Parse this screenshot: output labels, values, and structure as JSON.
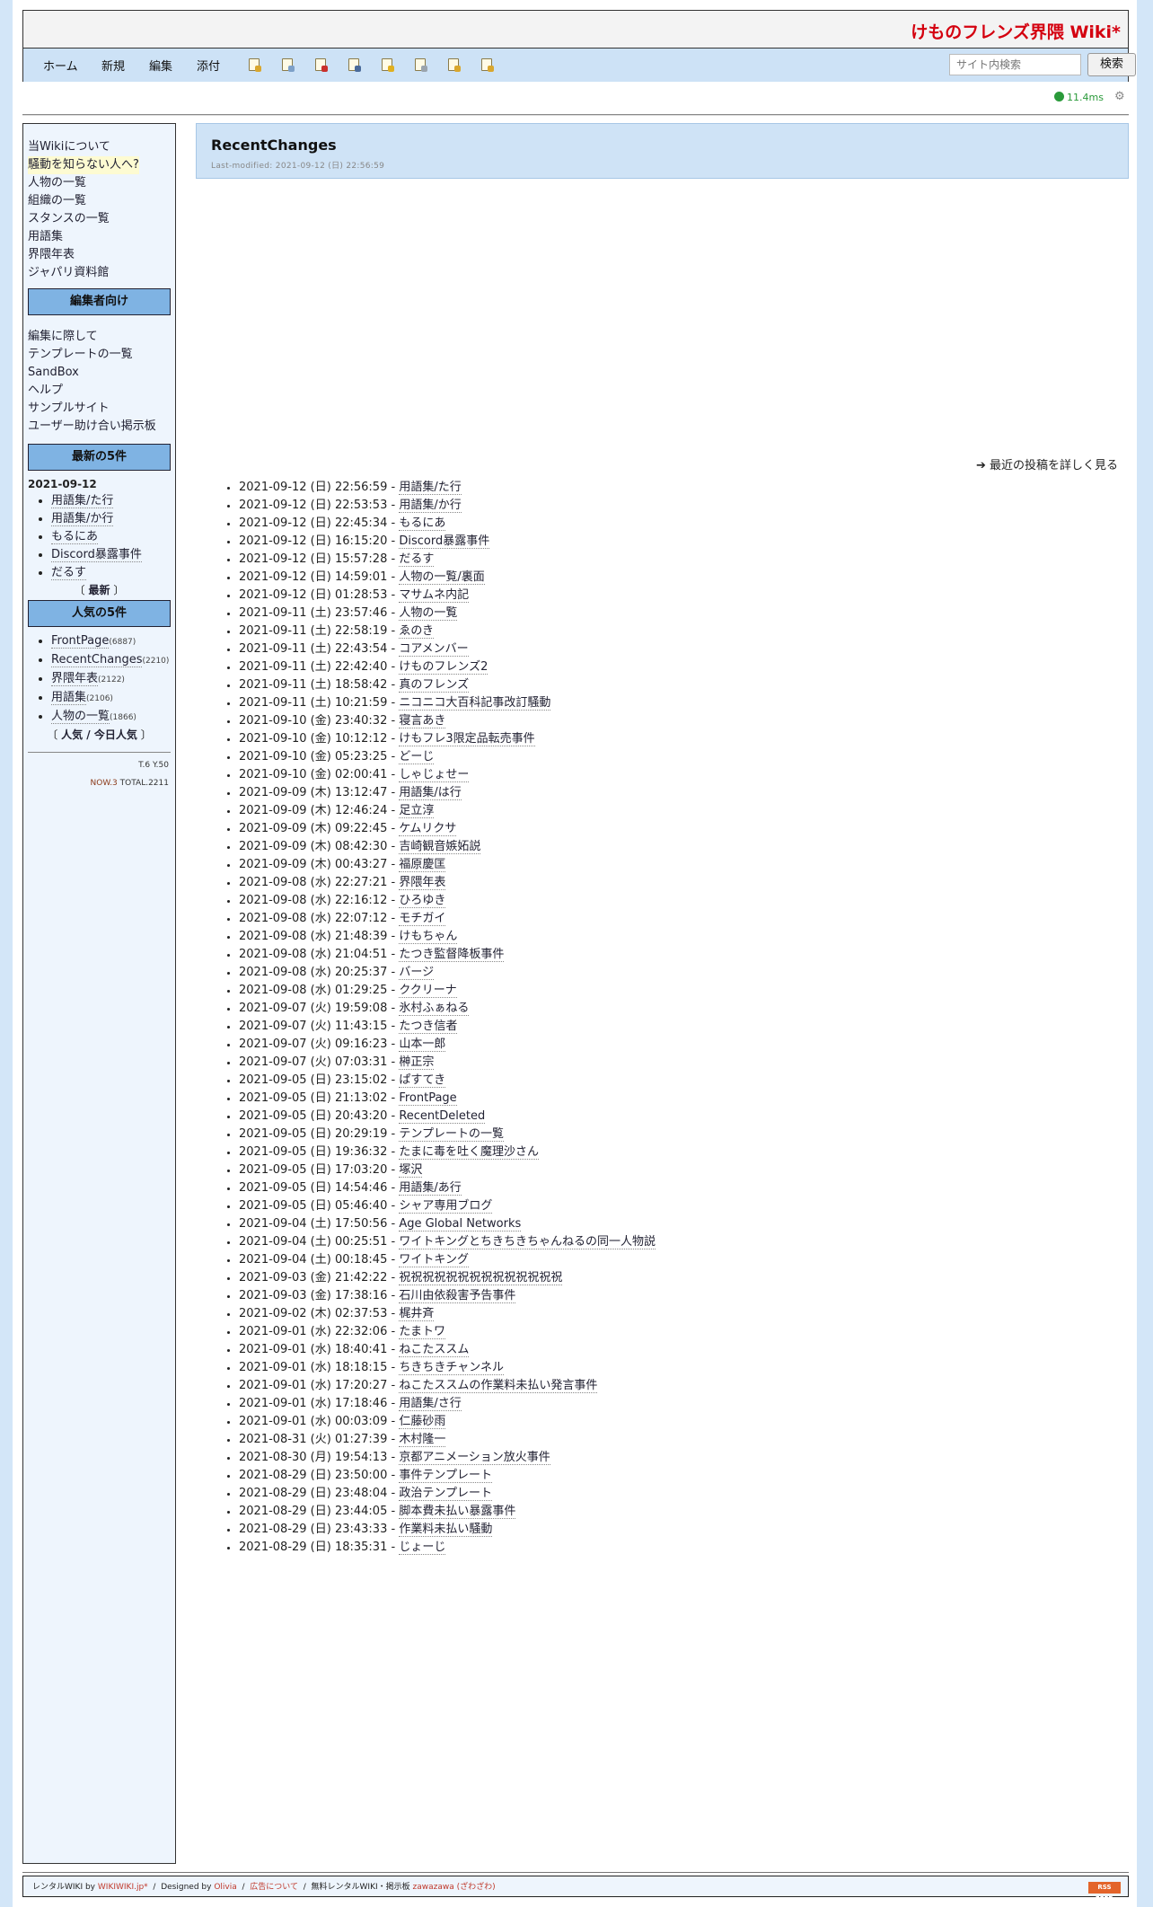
{
  "site_title": "けものフレンズ界隈 Wiki*",
  "menu": [
    "ホーム",
    "新規",
    "編集",
    "添付"
  ],
  "toolbar_icons": [
    "new-page-icon",
    "copy-page-icon",
    "diff-icon",
    "backup-icon",
    "lock-icon",
    "list-icon",
    "search-page-icon",
    "help-page-icon"
  ],
  "search": {
    "placeholder": "サイト内検索",
    "button": "検索"
  },
  "render_time": "11.4ms",
  "sidebar": {
    "links": [
      "当Wikiについて",
      "騒動を知らない人へ?",
      "人物の一覧",
      "組織の一覧",
      "スタンスの一覧",
      "用語集",
      "界隈年表",
      "ジャパリ資料館"
    ],
    "editors_heading": "編集者向け",
    "editor_links": [
      "編集に際して",
      "テンプレートの一覧",
      "SandBox",
      "ヘルプ",
      "サンプルサイト",
      "ユーザー助け合い掲示板"
    ],
    "recent_heading": "最新の5件",
    "recent_date": "2021-09-12",
    "recent": [
      "用語集/た行",
      "用語集/か行",
      "もるにあ",
      "Discord暴露事件",
      "だるす"
    ],
    "recent_more_open": "〔",
    "recent_more": "最新",
    "recent_more_close": "〕",
    "popular_heading": "人気の5件",
    "popular": [
      {
        "name": "FrontPage",
        "count": "(6887)"
      },
      {
        "name": "RecentChanges",
        "count": "(2210)"
      },
      {
        "name": "界隈年表",
        "count": "(2122)"
      },
      {
        "name": "用語集",
        "count": "(2106)"
      },
      {
        "name": "人物の一覧",
        "count": "(1866)"
      }
    ],
    "popular_more_open": "〔",
    "popular_more": "人気 / 今日人気",
    "popular_more_close": "〕",
    "counter_ty": "T.6 Y.50",
    "counter_now": "NOW.3",
    "counter_total": "TOTAL.2211"
  },
  "page": {
    "title": "RecentChanges",
    "last_modified": "Last-modified: 2021-09-12 (日) 22:56:59",
    "detail_link": "最近の投稿を詳しく見る"
  },
  "changes": [
    {
      "time": "2021-09-12 (日) 22:56:59",
      "page": "用語集/た行"
    },
    {
      "time": "2021-09-12 (日) 22:53:53",
      "page": "用語集/か行"
    },
    {
      "time": "2021-09-12 (日) 22:45:34",
      "page": "もるにあ"
    },
    {
      "time": "2021-09-12 (日) 16:15:20",
      "page": "Discord暴露事件"
    },
    {
      "time": "2021-09-12 (日) 15:57:28",
      "page": "だるす"
    },
    {
      "time": "2021-09-12 (日) 14:59:01",
      "page": "人物の一覧/裏面"
    },
    {
      "time": "2021-09-12 (日) 01:28:53",
      "page": "マサムネ内記"
    },
    {
      "time": "2021-09-11 (土) 23:57:46",
      "page": "人物の一覧"
    },
    {
      "time": "2021-09-11 (土) 22:58:19",
      "page": "ゑのき"
    },
    {
      "time": "2021-09-11 (土) 22:43:54",
      "page": "コアメンバー"
    },
    {
      "time": "2021-09-11 (土) 22:42:40",
      "page": "けものフレンズ2"
    },
    {
      "time": "2021-09-11 (土) 18:58:42",
      "page": "真のフレンズ"
    },
    {
      "time": "2021-09-11 (土) 10:21:59",
      "page": "ニコニコ大百科記事改訂騒動"
    },
    {
      "time": "2021-09-10 (金) 23:40:32",
      "page": "寝言あき"
    },
    {
      "time": "2021-09-10 (金) 10:12:12",
      "page": "けもフレ3限定品転売事件"
    },
    {
      "time": "2021-09-10 (金) 05:23:25",
      "page": "どーじ"
    },
    {
      "time": "2021-09-10 (金) 02:00:41",
      "page": "しゃじょせー"
    },
    {
      "time": "2021-09-09 (木) 13:12:47",
      "page": "用語集/は行"
    },
    {
      "time": "2021-09-09 (木) 12:46:24",
      "page": "足立淳"
    },
    {
      "time": "2021-09-09 (木) 09:22:45",
      "page": "ケムリクサ"
    },
    {
      "time": "2021-09-09 (木) 08:42:30",
      "page": "吉崎観音嫉妬説"
    },
    {
      "time": "2021-09-09 (木) 00:43:27",
      "page": "福原慶匡"
    },
    {
      "time": "2021-09-08 (水) 22:27:21",
      "page": "界隈年表"
    },
    {
      "time": "2021-09-08 (水) 22:16:12",
      "page": "ひろゆき"
    },
    {
      "time": "2021-09-08 (水) 22:07:12",
      "page": "モチガイ"
    },
    {
      "time": "2021-09-08 (水) 21:48:39",
      "page": "けもちゃん"
    },
    {
      "time": "2021-09-08 (水) 21:04:51",
      "page": "たつき監督降板事件"
    },
    {
      "time": "2021-09-08 (水) 20:25:37",
      "page": "バージ"
    },
    {
      "time": "2021-09-08 (水) 01:29:25",
      "page": "ククリーナ"
    },
    {
      "time": "2021-09-07 (火) 19:59:08",
      "page": "氷村ふぁねる"
    },
    {
      "time": "2021-09-07 (火) 11:43:15",
      "page": "たつき信者"
    },
    {
      "time": "2021-09-07 (火) 09:16:23",
      "page": "山本一郎"
    },
    {
      "time": "2021-09-07 (火) 07:03:31",
      "page": "榊正宗"
    },
    {
      "time": "2021-09-05 (日) 23:15:02",
      "page": "ぱすてき"
    },
    {
      "time": "2021-09-05 (日) 21:13:02",
      "page": "FrontPage"
    },
    {
      "time": "2021-09-05 (日) 20:43:20",
      "page": "RecentDeleted"
    },
    {
      "time": "2021-09-05 (日) 20:29:19",
      "page": "テンプレートの一覧"
    },
    {
      "time": "2021-09-05 (日) 19:36:32",
      "page": "たまに毒を吐く魔理沙さん"
    },
    {
      "time": "2021-09-05 (日) 17:03:20",
      "page": "塚沢"
    },
    {
      "time": "2021-09-05 (日) 14:54:46",
      "page": "用語集/あ行"
    },
    {
      "time": "2021-09-05 (日) 05:46:40",
      "page": "シャア専用ブログ"
    },
    {
      "time": "2021-09-04 (土) 17:50:56",
      "page": "Age Global Networks"
    },
    {
      "time": "2021-09-04 (土) 00:25:51",
      "page": "ワイトキングとちきちきちゃんねるの同一人物説"
    },
    {
      "time": "2021-09-04 (土) 00:18:45",
      "page": "ワイトキング"
    },
    {
      "time": "2021-09-03 (金) 21:42:22",
      "page": "祝祝祝祝祝祝祝祝祝祝祝祝祝祝"
    },
    {
      "time": "2021-09-03 (金) 17:38:16",
      "page": "石川由依殺害予告事件"
    },
    {
      "time": "2021-09-02 (木) 02:37:53",
      "page": "梶井斉"
    },
    {
      "time": "2021-09-01 (水) 22:32:06",
      "page": "たまトワ"
    },
    {
      "time": "2021-09-01 (水) 18:40:41",
      "page": "ねこたススム"
    },
    {
      "time": "2021-09-01 (水) 18:18:15",
      "page": "ちきちきチャンネル"
    },
    {
      "time": "2021-09-01 (水) 17:20:27",
      "page": "ねこたススムの作業料未払い発言事件"
    },
    {
      "time": "2021-09-01 (水) 17:18:46",
      "page": "用語集/さ行"
    },
    {
      "time": "2021-09-01 (水) 00:03:09",
      "page": "仁藤砂雨"
    },
    {
      "time": "2021-08-31 (火) 01:27:39",
      "page": "木村隆一"
    },
    {
      "time": "2021-08-30 (月) 19:54:13",
      "page": "京都アニメーション放火事件"
    },
    {
      "time": "2021-08-29 (日) 23:50:00",
      "page": "事件テンプレート"
    },
    {
      "time": "2021-08-29 (日) 23:48:04",
      "page": "政治テンプレート"
    },
    {
      "time": "2021-08-29 (日) 23:44:05",
      "page": "脚本費未払い暴露事件"
    },
    {
      "time": "2021-08-29 (日) 23:43:33",
      "page": "作業料未払い騒動"
    },
    {
      "time": "2021-08-29 (日) 18:35:31",
      "page": "じょーじ"
    }
  ],
  "footer": {
    "rental": "レンタルWIKI by",
    "wikiwiki": "WIKIWIKI.jp*",
    "sep1": "/",
    "designed_by": "Designed by",
    "designer": "Olivia",
    "sep2": "/",
    "ads": "広告について",
    "sep3": "/",
    "board_label": "無料レンタルWIKI・掲示板",
    "board": "zawazawa",
    "board_reading": "(ざわざわ)",
    "rss": "RSS FEED"
  },
  "colors": {
    "background": "#d3e6f8",
    "title_red": "#d4000f",
    "menu_bar": "#cde2f6",
    "side_heading": "#7fb3e3",
    "render_time_green": "#2a9a3a"
  }
}
